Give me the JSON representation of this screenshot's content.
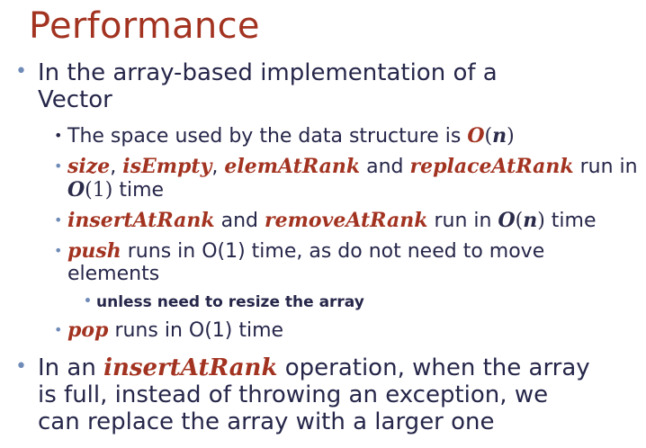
{
  "title": "Performance",
  "b1": {
    "line1": "In the array-based implementation of a",
    "line2": "Vector"
  },
  "b1_1": {
    "text": "The space used by the data structure is ",
    "O": "O",
    "open": "(",
    "n": "n",
    "close": ")"
  },
  "b1_2": {
    "size": "size",
    "comma1": ", ",
    "isEmpty": "isEmpty",
    "comma2": ", ",
    "elemAtRank": "elemAtRank",
    "and": " and ",
    "replaceAtRank": "replaceAtRank",
    "run_in": " run in",
    "O": "O",
    "one": "(1)",
    "time": " time"
  },
  "b1_3": {
    "insertAtRank": "insertAtRank",
    "and": " and ",
    "removeAtRank": "removeAtRank",
    "run_in": " run in ",
    "O": "O",
    "open": "(",
    "n": "n",
    "close": ")",
    "time": " time"
  },
  "b1_4": {
    "push": "push",
    "line1": " runs in O(1) time, as do not need to move",
    "line2": "elements"
  },
  "b1_4_1": {
    "text": "unless need to resize the array"
  },
  "b1_5": {
    "pop": "pop",
    "text": " runs in O(1) time"
  },
  "b2": {
    "in_an": "In an ",
    "insertAtRank": "insertAtRank",
    "line1_rest": " operation, when the array",
    "line2": "is full, instead of throwing an exception, we",
    "line3": "can replace the array with a larger one"
  }
}
